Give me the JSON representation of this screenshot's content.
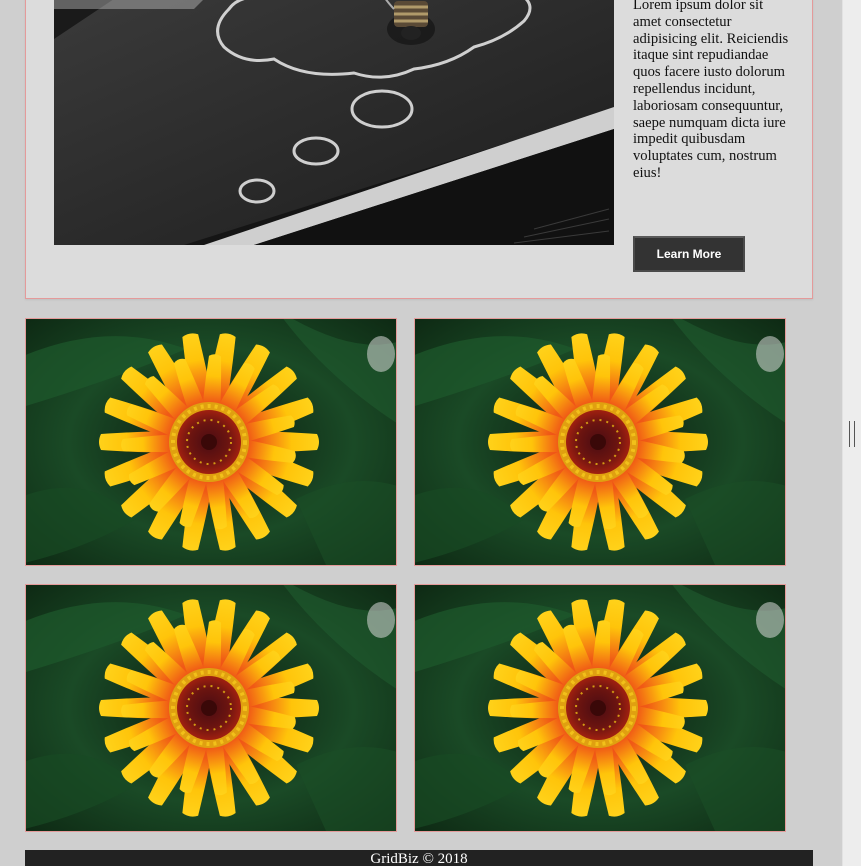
{
  "hero": {
    "image_icon": "chalkboard-lightbulb-image",
    "text": "Lorem ipsum dolor sit amet consectetur adipisicing elit. Reiciendis itaque sint repudiandae quos facere iusto dolorum repellendus incidunt, laboriosam consequuntur, saepe numquam dicta iure impedit quibusdam voluptates cum, nostrum eius!",
    "button_label": "Learn More"
  },
  "gallery": {
    "items": [
      {
        "icon": "zinnia-flower-image"
      },
      {
        "icon": "zinnia-flower-image"
      },
      {
        "icon": "zinnia-flower-image"
      },
      {
        "icon": "zinnia-flower-image"
      }
    ]
  },
  "footer": {
    "text": "GridBiz © 2018"
  },
  "colors": {
    "page_background": "#cfcfcf",
    "hero_background": "#dcdcdc",
    "border_accent": "#e49a9a",
    "button_background": "#333333",
    "footer_background": "#222222"
  }
}
